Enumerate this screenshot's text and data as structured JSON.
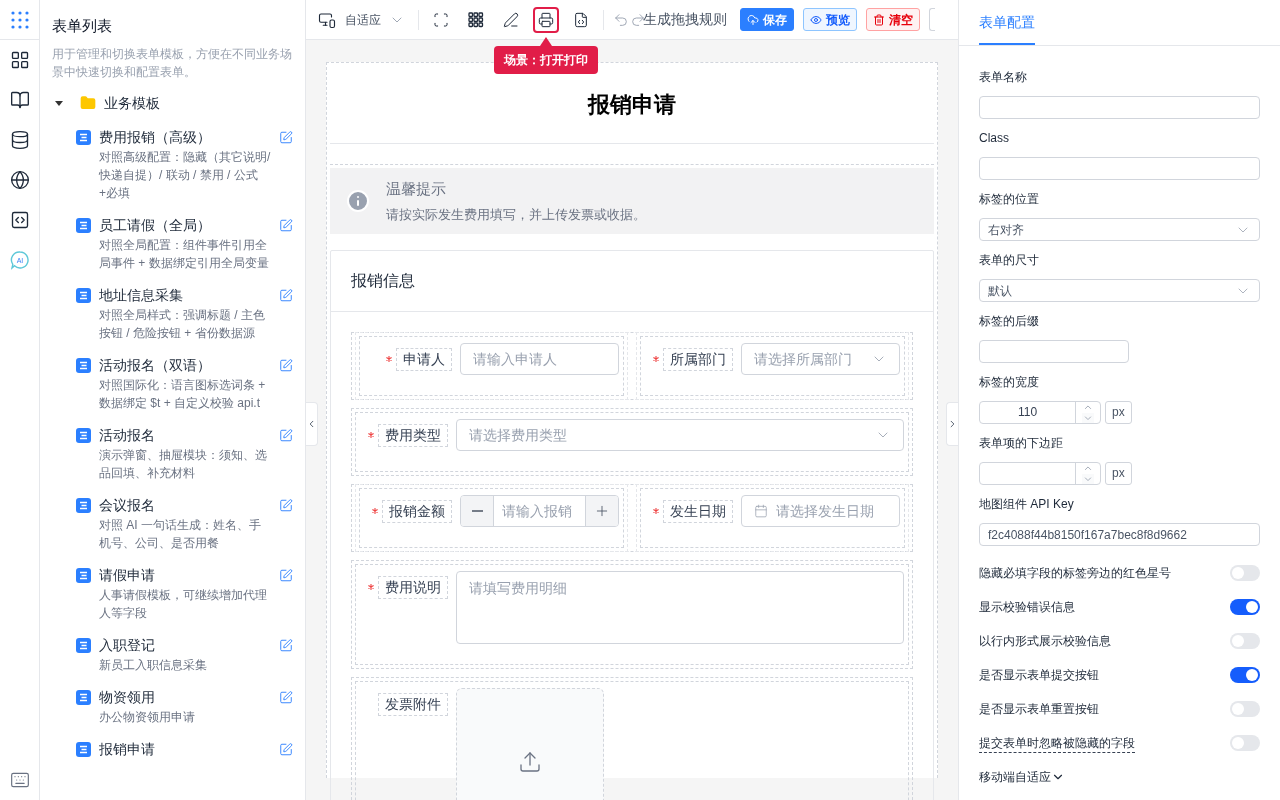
{
  "rail": {
    "ai_badge": "AI"
  },
  "sidebar": {
    "title": "表单列表",
    "description": "用于管理和切换表单模板，方便在不同业务场景中快速切换和配置表单。",
    "folder": {
      "label": "业务模板",
      "expanded": true
    },
    "items": [
      {
        "title": "费用报销（高级）",
        "description": "对照高级配置：隐藏（其它说明/快递自提）/ 联动 / 禁用 / 公式+必填"
      },
      {
        "title": "员工请假（全局）",
        "description": "对照全局配置：组件事件引用全局事件 + 数据绑定引用全局变量"
      },
      {
        "title": "地址信息采集",
        "description": "对照全局样式：强调标题 / 主色按钮 / 危险按钮 + 省份数据源"
      },
      {
        "title": "活动报名（双语）",
        "description": "对照国际化：语言图标选词条 + 数据绑定 $t + 自定义校验 api.t"
      },
      {
        "title": "活动报名",
        "description": "演示弹窗、抽屉模块：须知、选品回填、补充材料"
      },
      {
        "title": "会议报名",
        "description": "对照 AI 一句话生成：姓名、手机号、公司、是否用餐"
      },
      {
        "title": "请假申请",
        "description": "人事请假模板，可继续增加代理人等字段"
      },
      {
        "title": "入职登记",
        "description": "新员工入职信息采集"
      },
      {
        "title": "物资领用",
        "description": "办公物资领用申请"
      },
      {
        "title": "报销申请"
      }
    ]
  },
  "toolbar": {
    "device": "自适应",
    "tools": [
      {
        "selected": false
      },
      {
        "selected": false
      },
      {
        "selected": false
      },
      {
        "selected": true
      },
      {
        "selected": false
      }
    ],
    "tooltip": "场景：打开打印",
    "rules": "生成拖拽规则",
    "buttons": [
      {
        "label": "保存",
        "kind": "primary"
      },
      {
        "label": "预览",
        "kind": "info"
      },
      {
        "label": "清空",
        "kind": "danger"
      }
    ]
  },
  "form": {
    "title": "报销申请",
    "alert": {
      "title": "温馨提示",
      "text": "请按实际发生费用填写，并上传发票或收据。"
    },
    "card": {
      "title": "报销信息",
      "rows": [
        {
          "fields": [
            {
              "label": "申请人",
              "required": true,
              "kind": "input",
              "placeholder": "请输入申请人"
            },
            {
              "label": "所属部门",
              "required": true,
              "kind": "select",
              "placeholder": "请选择所属部门"
            }
          ]
        },
        {
          "fields": [
            {
              "label": "费用类型",
              "required": true,
              "kind": "select",
              "placeholder": "请选择费用类型"
            }
          ]
        },
        {
          "fields": [
            {
              "label": "报销金额",
              "required": true,
              "kind": "number",
              "placeholder": "请输入报销"
            },
            {
              "label": "发生日期",
              "required": true,
              "kind": "date",
              "placeholder": "请选择发生日期"
            }
          ]
        },
        {
          "fields": [
            {
              "label": "费用说明",
              "required": true,
              "kind": "textarea",
              "placeholder": "请填写费用明细"
            }
          ]
        },
        {
          "fields": [
            {
              "label": "发票附件",
              "required": false,
              "kind": "upload"
            }
          ]
        }
      ]
    }
  },
  "config": {
    "tabs": [
      {
        "label": "表单配置",
        "selected": true
      }
    ],
    "items": [
      {
        "kind": "text",
        "label": "表单名称"
      },
      {
        "kind": "text",
        "label": "Class"
      },
      {
        "kind": "select",
        "label": "标签的位置",
        "value": "右对齐"
      },
      {
        "kind": "select",
        "label": "表单的尺寸",
        "value": "默认"
      },
      {
        "kind": "short",
        "label": "标签的后缀"
      },
      {
        "kind": "number",
        "label": "标签的宽度",
        "value": "110",
        "suffix": "px"
      },
      {
        "kind": "number",
        "label": "表单项的下边距",
        "suffix": "px"
      },
      {
        "kind": "text",
        "label": "地图组件 API Key",
        "value": "f2c4088f44b8150f167a7bec8f8d9662"
      },
      {
        "kind": "switch",
        "label": "隐藏必填字段的标签旁边的红色星号",
        "on": false,
        "hint": false
      },
      {
        "kind": "switch",
        "label": "显示校验错误信息",
        "on": true,
        "hint": false
      },
      {
        "kind": "switch",
        "label": "以行内形式展示校验信息",
        "on": false,
        "hint": false
      },
      {
        "kind": "switch",
        "label": "是否显示表单提交按钮",
        "on": true,
        "hint": false
      },
      {
        "kind": "switch",
        "label": "是否显示表单重置按钮",
        "on": false,
        "hint": false
      },
      {
        "kind": "switch",
        "label": "提交表单时忽略被隐藏的字段",
        "on": false,
        "hint": true
      },
      {
        "kind": "collapse",
        "label": "移动端自适应"
      }
    ]
  }
}
